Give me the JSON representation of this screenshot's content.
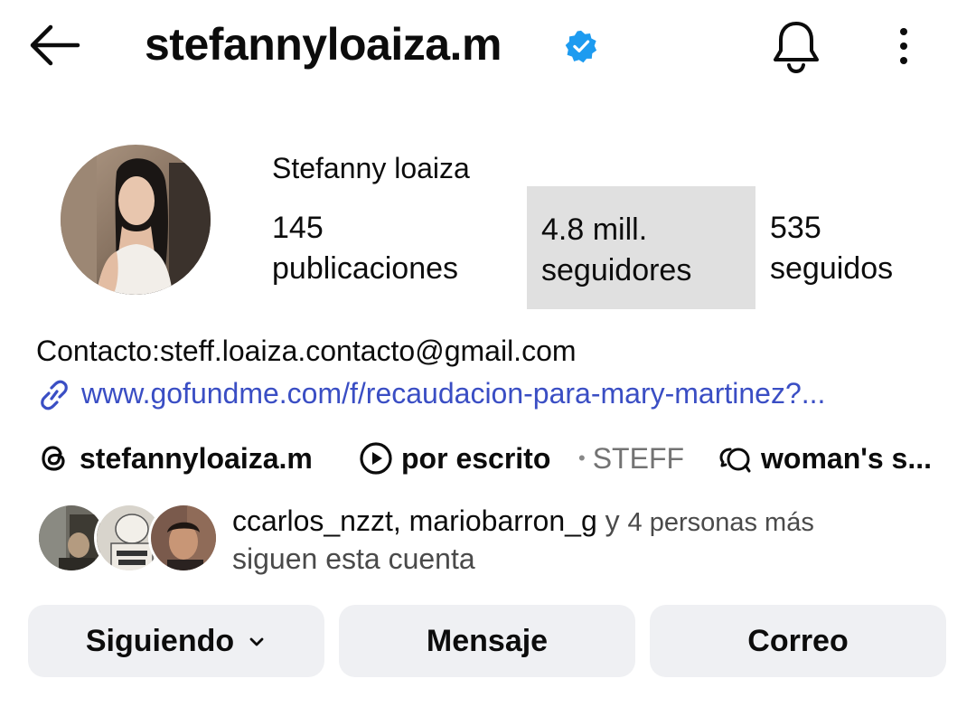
{
  "header": {
    "username": "stefannyloaiza.m",
    "back_icon": "arrow-left-icon",
    "verified_icon": "verified-badge-icon",
    "notifications_icon": "bell-icon",
    "more_icon": "more-vertical-icon",
    "verified_color": "#1d9bf0"
  },
  "profile": {
    "display_name": "Stefanny loaiza",
    "stats": {
      "posts": {
        "value": "145",
        "label": "publicaciones"
      },
      "followers": {
        "value": "4.8 mill.",
        "label": "seguidores"
      },
      "following": {
        "value": "535",
        "label": "seguidos"
      }
    },
    "bio": {
      "contact": "Contacto:steff.loaiza.contacto@gmail.com",
      "link": "www.gofundme.com/f/recaudacion-para-mary-martinez?...",
      "link_color": "#3a4ec4"
    },
    "chips": {
      "threads": "stefannyloaiza.m",
      "video": "por escrito",
      "separator": "•",
      "subtitle": "STEFF",
      "topic": "woman's s..."
    },
    "followed_by": {
      "names": "ccarlos_nzzt, mariobarron_g",
      "connector": "y",
      "count_text": "4 personas más",
      "suffix": "siguen esta cuenta"
    }
  },
  "actions": {
    "following": "Siguiendo",
    "message": "Mensaje",
    "email": "Correo"
  }
}
